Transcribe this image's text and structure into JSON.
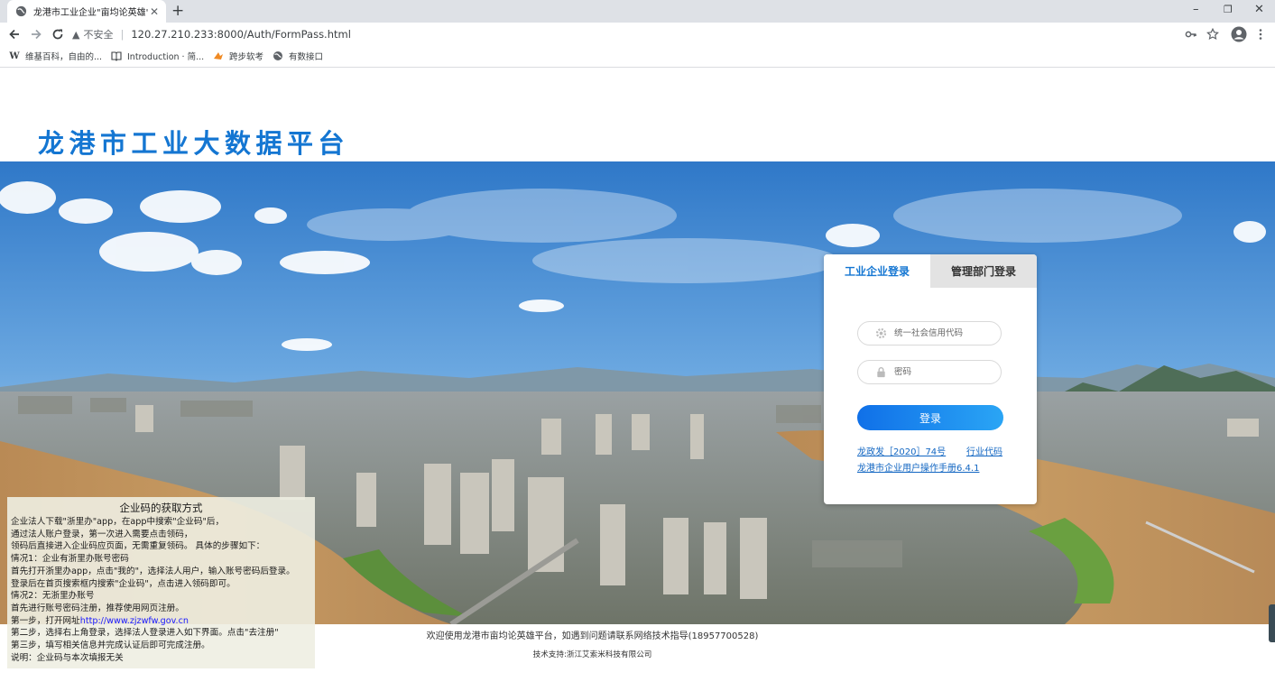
{
  "browser": {
    "tab_title": "龙港市工业企业\"亩均论英雄\"综合评价",
    "tab_close": "✕",
    "new_tab": "+",
    "window_controls": {
      "minimize": "–",
      "restore": "❐",
      "close": "✕"
    },
    "address": {
      "security_warning": "不安全",
      "url": "120.27.210.233:8000/Auth/FormPass.html"
    },
    "bookmarks": [
      {
        "icon": "W",
        "label": "维基百科，自由的..."
      },
      {
        "icon": "book-icon",
        "label": "Introduction · 简..."
      },
      {
        "icon": "kuabu-icon",
        "label": "跨步软考"
      },
      {
        "icon": "globe-icon",
        "label": "有数接口"
      }
    ]
  },
  "page": {
    "site_title": "龙港市工业大数据平台",
    "login": {
      "tabs": [
        {
          "label": "工业企业登录",
          "active": true
        },
        {
          "label": "管理部门登录",
          "active": false
        }
      ],
      "credit_code_placeholder": "统一社会信用代码",
      "password_placeholder": "密码",
      "submit_label": "登录",
      "links": {
        "policy": "龙政发［2020］74号",
        "industry_code": "行业代码",
        "manual": "龙港市企业用户操作手册6.4.1"
      }
    },
    "info_panel": {
      "title": "企业码的获取方式",
      "lines": [
        "企业法人下载\"浙里办\"app，在app中搜索\"企业码\"后，",
        "通过法人账户登录，第一次进入需要点击领码，",
        "领码后直接进入企业码应页面，无需重复领码。 具体的步骤如下：",
        "情况1：企业有浙里办账号密码",
        "首先打开浙里办app，点击\"我的\"，选择法人用户，输入账号密码后登录。",
        "登录后在首页搜索框内搜索\"企业码\"，点击进入领码即可。",
        "情况2：无浙里办账号",
        "首先进行账号密码注册，推荐使用网页注册。"
      ],
      "step1_prefix": "第一步，打开网址",
      "step1_link": "http://www.zjzwfw.gov.cn",
      "lines_after": [
        "第二步，选择右上角登录，选择法人登录进入如下界面。点击\"去注册\"",
        "第三步，填写相关信息并完成认证后即可完成注册。",
        "说明：企业码与本次填报无关"
      ]
    },
    "footer": {
      "welcome": "欢迎使用龙港市亩均论英雄平台，如遇到问题请联系网络技术指导(18957700528)",
      "support": "技术支持:浙江艾索米科技有限公司"
    }
  }
}
